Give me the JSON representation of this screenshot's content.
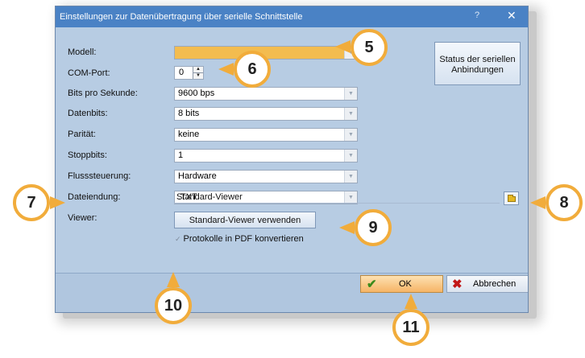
{
  "dialog": {
    "title": "Einstellungen zur Datenübertragung über serielle Schnittstelle",
    "help_label": "?",
    "close_label": "✕"
  },
  "fields": {
    "modell_label": "Modell:",
    "modell_value": "",
    "com_label": "COM-Port:",
    "com_value": "0",
    "bits_label": "Bits pro Sekunde:",
    "bits_value": "9600 bps",
    "datenbits_label": "Datenbits:",
    "datenbits_value": "8 bits",
    "paritaet_label": "Parität:",
    "paritaet_value": "keine",
    "stoppbits_label": "Stoppbits:",
    "stoppbits_value": "1",
    "fluss_label": "Flusssteuerung:",
    "fluss_value": "Hardware",
    "endung_label": "Dateiendung:",
    "endung_value": ".TXT",
    "viewer_label": "Viewer:",
    "viewer_value": "Standard-Viewer"
  },
  "buttons": {
    "status_label": "Status der seriellen Anbindungen",
    "standard_viewer_label": "Standard-Viewer verwenden",
    "ok_label": "OK",
    "cancel_label": "Abbrechen"
  },
  "checkbox": {
    "pdf_label": "Protokolle in PDF konvertieren",
    "pdf_checked": true
  },
  "callouts": [
    "5",
    "6",
    "7",
    "8",
    "9",
    "10",
    "11"
  ],
  "colors": {
    "titlebar": "#4a82c5",
    "dialog_bg": "#b7cce3",
    "callout_border": "#f1ac3b",
    "modell_highlight": "#f3bc4f",
    "ok_button": "#f6b466"
  }
}
